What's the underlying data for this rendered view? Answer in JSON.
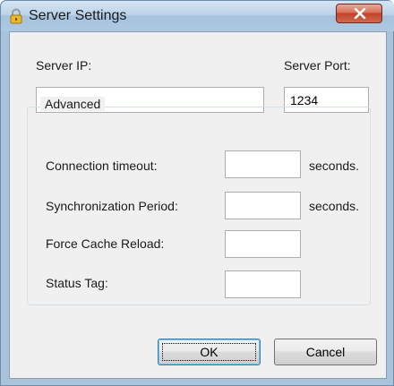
{
  "window": {
    "title": "Server Settings",
    "title_icon": "lock-icon",
    "close_icon": "close-icon"
  },
  "form": {
    "server_ip_label": "Server IP:",
    "server_ip_value": "",
    "server_port_label": "Server Port:",
    "server_port_value": "1234"
  },
  "advanced": {
    "group_label": "Advanced",
    "connection_timeout_label": "Connection timeout:",
    "connection_timeout_value": "",
    "connection_timeout_unit": "seconds.",
    "sync_period_label": "Synchronization Period:",
    "sync_period_value": "",
    "sync_period_unit": "seconds.",
    "force_cache_label": "Force Cache Reload:",
    "force_cache_value": "",
    "status_tag_label": "Status Tag:",
    "status_tag_value": ""
  },
  "buttons": {
    "ok_label": "OK",
    "cancel_label": "Cancel"
  },
  "colors": {
    "close_button": "#c7432a",
    "default_button_border": "#3c7fb1"
  }
}
